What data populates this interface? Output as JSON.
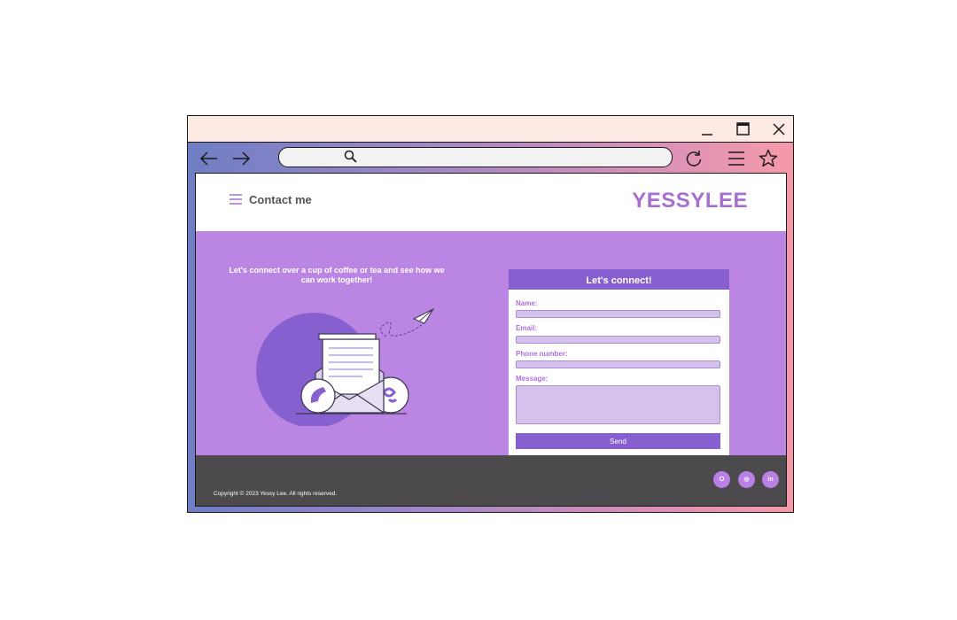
{
  "window": {
    "controls": [
      "minimize-icon",
      "maximize-icon",
      "close-icon"
    ]
  },
  "toolbar": {
    "url_value": "",
    "icons": [
      "back-arrow-icon",
      "forward-arrow-icon",
      "search-icon",
      "reload-icon",
      "menu-icon",
      "star-icon"
    ]
  },
  "site": {
    "menu_label": "Contact me",
    "brand": "YESSYLEE"
  },
  "hero": {
    "tagline": "Let's connect over a cup of coffee or tea and see how we can work together!"
  },
  "form": {
    "title": "Let's connect!",
    "name_label": "Name:",
    "email_label": "Email:",
    "phone_label": "Phone number:",
    "message_label": "Message:",
    "send_label": "Send"
  },
  "footer": {
    "copyright": "Copyright © 2023 Yessy Lee. All rights reserved.",
    "social": [
      {
        "icon": "github-icon",
        "glyph": "⭘"
      },
      {
        "icon": "instagram-icon",
        "glyph": "◎"
      },
      {
        "icon": "linkedin-icon",
        "glyph": "in"
      }
    ]
  },
  "colors": {
    "accent_purple": "#875fd0",
    "hero_bg": "#bb86e3",
    "brand": "#a66fd0",
    "footer_bg": "#4c4a4d"
  }
}
